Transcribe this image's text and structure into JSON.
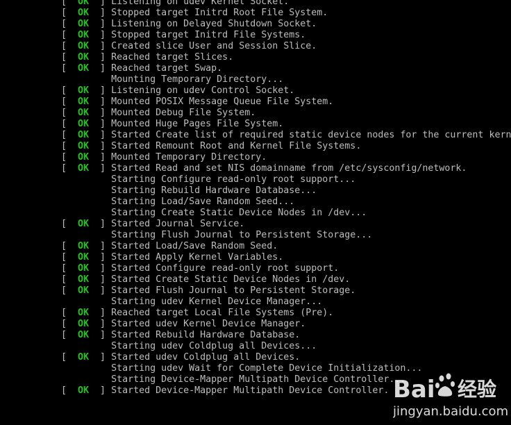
{
  "console": {
    "status_text": "OK",
    "lines": [
      {
        "status": "OK",
        "text": "Listening on udev Kernel Socket."
      },
      {
        "status": "OK",
        "text": "Stopped target Initrd Root File System."
      },
      {
        "status": "OK",
        "text": "Listening on Delayed Shutdown Socket."
      },
      {
        "status": "OK",
        "text": "Stopped target Initrd File Systems."
      },
      {
        "status": "OK",
        "text": "Created slice User and Session Slice."
      },
      {
        "status": "OK",
        "text": "Reached target Slices."
      },
      {
        "status": "OK",
        "text": "Reached target Swap."
      },
      {
        "status": "",
        "text": "Mounting Temporary Directory..."
      },
      {
        "status": "OK",
        "text": "Listening on udev Control Socket."
      },
      {
        "status": "OK",
        "text": "Mounted POSIX Message Queue File System."
      },
      {
        "status": "OK",
        "text": "Mounted Debug File System."
      },
      {
        "status": "OK",
        "text": "Mounted Huge Pages File System."
      },
      {
        "status": "OK",
        "text": "Started Create list of required static device nodes for the current kernel."
      },
      {
        "status": "OK",
        "text": "Started Remount Root and Kernel File Systems."
      },
      {
        "status": "OK",
        "text": "Mounted Temporary Directory."
      },
      {
        "status": "OK",
        "text": "Started Read and set NIS domainname from /etc/sysconfig/network."
      },
      {
        "status": "",
        "text": "Starting Configure read-only root support..."
      },
      {
        "status": "",
        "text": "Starting Rebuild Hardware Database..."
      },
      {
        "status": "",
        "text": "Starting Load/Save Random Seed..."
      },
      {
        "status": "",
        "text": "Starting Create Static Device Nodes in /dev..."
      },
      {
        "status": "OK",
        "text": "Started Journal Service."
      },
      {
        "status": "",
        "text": "Starting Flush Journal to Persistent Storage..."
      },
      {
        "status": "OK",
        "text": "Started Load/Save Random Seed."
      },
      {
        "status": "OK",
        "text": "Started Apply Kernel Variables."
      },
      {
        "status": "OK",
        "text": "Started Configure read-only root support."
      },
      {
        "status": "OK",
        "text": "Started Create Static Device Nodes in /dev."
      },
      {
        "status": "OK",
        "text": "Started Flush Journal to Persistent Storage."
      },
      {
        "status": "",
        "text": "Starting udev Kernel Device Manager..."
      },
      {
        "status": "OK",
        "text": "Reached target Local File Systems (Pre)."
      },
      {
        "status": "OK",
        "text": "Started udev Kernel Device Manager."
      },
      {
        "status": "OK",
        "text": "Started Rebuild Hardware Database."
      },
      {
        "status": "",
        "text": "Starting udev Coldplug all Devices..."
      },
      {
        "status": "OK",
        "text": "Started udev Coldplug all Devices."
      },
      {
        "status": "",
        "text": "Starting udev Wait for Complete Device Initialization..."
      },
      {
        "status": "",
        "text": "Starting Device-Mapper Multipath Device Controller..."
      },
      {
        "status": "OK",
        "text": "Started Device-Mapper Multipath Device Controller."
      }
    ]
  },
  "watermark": {
    "brand": "Bai",
    "brand_cn": "经验",
    "url": "jingyan.baidu.com",
    "paw_color": "#ffffff"
  },
  "colors": {
    "background": "#000000",
    "text": "#bdbdbd",
    "ok": "#22c322"
  }
}
